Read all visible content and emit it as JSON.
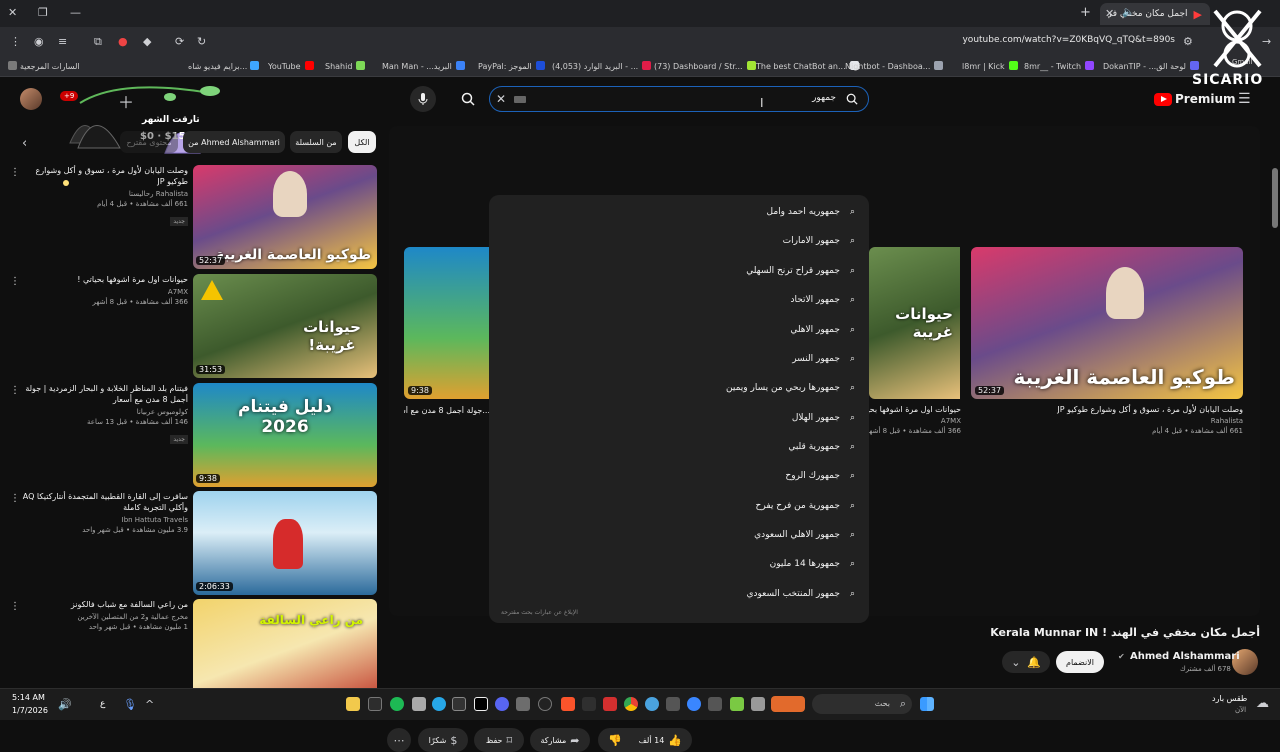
{
  "browser": {
    "tab_title": "أجمل مكان مخفي في...",
    "url": "youtube.com/watch?v=Z0KBqVQ_qTQ&t=890s",
    "bookmarks": [
      {
        "label": "السارات المرجعية",
        "color": "#7a7a7a"
      },
      {
        "label": "برايم فيديو شاه...",
        "color": "#3ea6ff"
      },
      {
        "label": "YouTube",
        "color": "#ff0000"
      },
      {
        "label": "Shahid",
        "color": "#7ed957"
      },
      {
        "label": "Man Man - ...البريد",
        "color": "#3b82f6"
      },
      {
        "label": "PayPal: الموجز",
        "color": "#1d4ed8"
      },
      {
        "label": "(4,053) البريد الوارد - ...",
        "color": "#e11d48"
      },
      {
        "label": "(73) Dashboard / Str...",
        "color": "#a3e635"
      },
      {
        "label": "The best ChatBot an...",
        "color": "#e5e7eb"
      },
      {
        "label": "Nightbot - Dashboa...",
        "color": "#9ca3af"
      },
      {
        "label": "l8mr | Kick",
        "color": "#53fc18"
      },
      {
        "label": "8mr__ - Twitch",
        "color": "#9146ff"
      },
      {
        "label": "DokanTIP - ...لوحة الق",
        "color": "#6366f1"
      }
    ],
    "bookmark_overflow": "Gmail"
  },
  "overlay": {
    "target_label": "تارقت الشهر",
    "target_value": "$0 · $1500",
    "followers_badge": "+9",
    "watermark": "SICARIO"
  },
  "youtube": {
    "search_value": "جمهور",
    "premium_label": "Premium",
    "chips": [
      "الكل",
      "من السلسلة",
      "من Ahmed Alshammari",
      "محتوى مقترح"
    ],
    "suggestions": [
      "جمهوريه احمد وامل",
      "جمهور الامارات",
      "جمهور قراح ترنح السهلي",
      "جمهور الاتحاد",
      "جمهور الاهلي",
      "جمهور النسر",
      "جمهورها ربحي من يسار ويمين",
      "جمهور الهلال",
      "جمهورية قلبي",
      "جمهورك الروح",
      "جمهورية من فرح يفرح",
      "جمهور الاهلي السعودي",
      "جمهورها 14 مليون",
      "جمهور المنتخب السعودي"
    ],
    "report_text": "الإبلاغ عن عبارات بحث مقترحة",
    "recommendations": [
      {
        "title": "وصلت اليابان لأول مرة ، تسوق و أكل وشوارع طوكيو JP",
        "channel": "Rahalista رحاليستا",
        "stats": "661 ألف مشاهدة • قبل 4 أيام",
        "badge": "جديد",
        "duration": "52:37",
        "thumb_text": "طوكيو العاصمة الغريبة",
        "colors": [
          "#d93a6b",
          "#f5c542"
        ]
      },
      {
        "title": "حيوانات اول مرة اشوفها بحياتي !",
        "channel": "A7MX",
        "stats": "366 ألف مشاهدة • قبل 8 أشهر",
        "badge": "",
        "duration": "31:53",
        "thumb_text": "حيوانات غريبة!",
        "colors": [
          "#6b8e4e",
          "#e8c07a"
        ]
      },
      {
        "title": "فيتنام بلد المناظر الخلابة و البحار الزمردية | جولة أجمل 8 مدن مع أسعار",
        "channel": "كولومبوس عربيانا",
        "stats": "146 ألف مشاهدة • قبل 13 ساعة",
        "badge": "جديد",
        "duration": "9:38",
        "thumb_text": "دليل فيتنام 2026",
        "colors": [
          "#1e88c8",
          "#e0a030"
        ]
      },
      {
        "title": "سافرت إلى القارة القطبية المتجمدة أنتاركتيكا AQ وأكلي التجربة كاملة",
        "channel": "Ibn Hattuta Travels",
        "stats": "3.9 مليون مشاهدة • قبل شهر واحد",
        "badge": "",
        "duration": "2:06:33",
        "thumb_text": "",
        "colors": [
          "#9fd3ee",
          "#2b6a9b"
        ]
      },
      {
        "title": "من راعي السالفة مع شباب فالكونز",
        "channel": "مخرج عمالية و2 من المتصلين الآخرين",
        "stats": "1 مليون مشاهدة • قبل شهر واحد",
        "badge": "",
        "duration": "",
        "thumb_text": "من راعي السالفة",
        "colors": [
          "#f2d36b",
          "#c0392b"
        ]
      }
    ],
    "endscreen": [
      {
        "title": "وصلت اليابان لأول مرة ، تسوق و أكل وشوارع طوكيو JP",
        "channel": "Rahalista",
        "stats": "661 ألف مشاهدة • قبل 4 أيام",
        "duration": "52:37",
        "thumb_text": "طوكيو العاصمة الغريبة"
      },
      {
        "title": "حيوانات اول مرة اشوفها بحياتي",
        "channel": "A7MX",
        "stats": "366 ألف مشاهدة • قبل 8 أشهر",
        "duration": "",
        "thumb_text": "حيوانات غريبة"
      },
      {
        "title": "...جولة أجمل 8 مدن مع أسعار",
        "channel": "",
        "stats": "",
        "duration": "9:38",
        "thumb_text": ""
      }
    ],
    "video_title": "أجمل مكان مخفي في الهند ! Kerala Munnar IN",
    "channel_name": "Ahmed Alshammari",
    "subscribers": "678 ألف مشترك",
    "join_label": "الانضمام",
    "like_count": "14 ألف",
    "share_label": "مشاركة",
    "save_label": "حفظ",
    "thanks_label": "شكرًا"
  },
  "taskbar": {
    "time": "5:14 AM",
    "date": "1/7/2026",
    "weather_label": "طقس بارد",
    "weather_sub": "الآن",
    "search_placeholder": "بحث",
    "lang": "ع"
  }
}
